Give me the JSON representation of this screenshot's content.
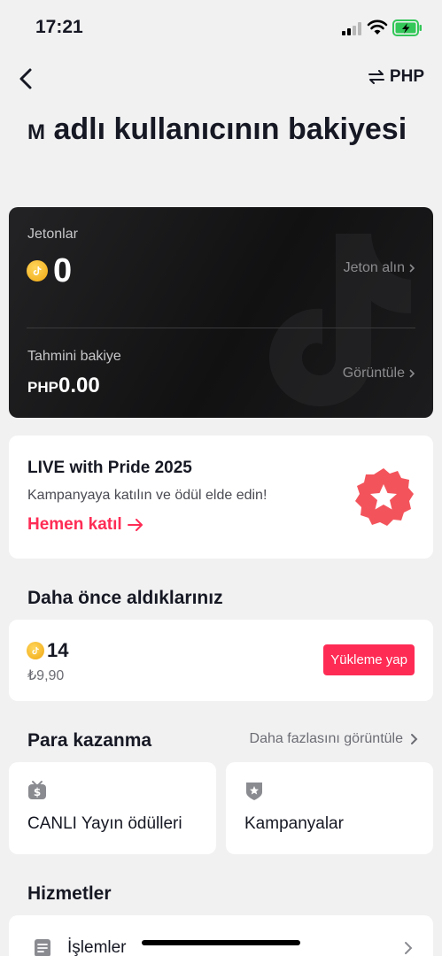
{
  "status": {
    "time": "17:21"
  },
  "nav": {
    "currency_label": "PHP"
  },
  "title": {
    "initial": "M",
    "text": " adlı kullanıcının bakiyesi"
  },
  "balance": {
    "coins_label": "Jetonlar",
    "coins_value": "0",
    "get_coins_link": "Jeton alın",
    "estimate_label": "Tahmini bakiye",
    "estimate_currency": "PHP",
    "estimate_value": "0.00",
    "view_link": "Görüntüle"
  },
  "promo": {
    "title": "LIVE with Pride 2025",
    "subtitle": "Kampanyaya katılın ve ödül elde edin!",
    "cta": "Hemen katıl"
  },
  "previous": {
    "heading": "Daha önce aldıklarınız",
    "coins": "14",
    "price": "₺9,90",
    "recharge_label": "Yükleme yap"
  },
  "monetization": {
    "heading": "Para kazanma",
    "more_link": "Daha fazlasını görüntüle",
    "tiles": [
      {
        "label": "CANLI Yayın ödülleri",
        "icon": "money-tv-icon"
      },
      {
        "label": "Kampanyalar",
        "icon": "star-badge-icon"
      }
    ]
  },
  "services": {
    "heading": "Hizmetler",
    "items": [
      {
        "label": "İşlemler",
        "icon": "document-icon"
      }
    ]
  },
  "colors": {
    "accent": "#fe2c55",
    "coin": "#f5b41f",
    "card_dark": "#161617"
  }
}
